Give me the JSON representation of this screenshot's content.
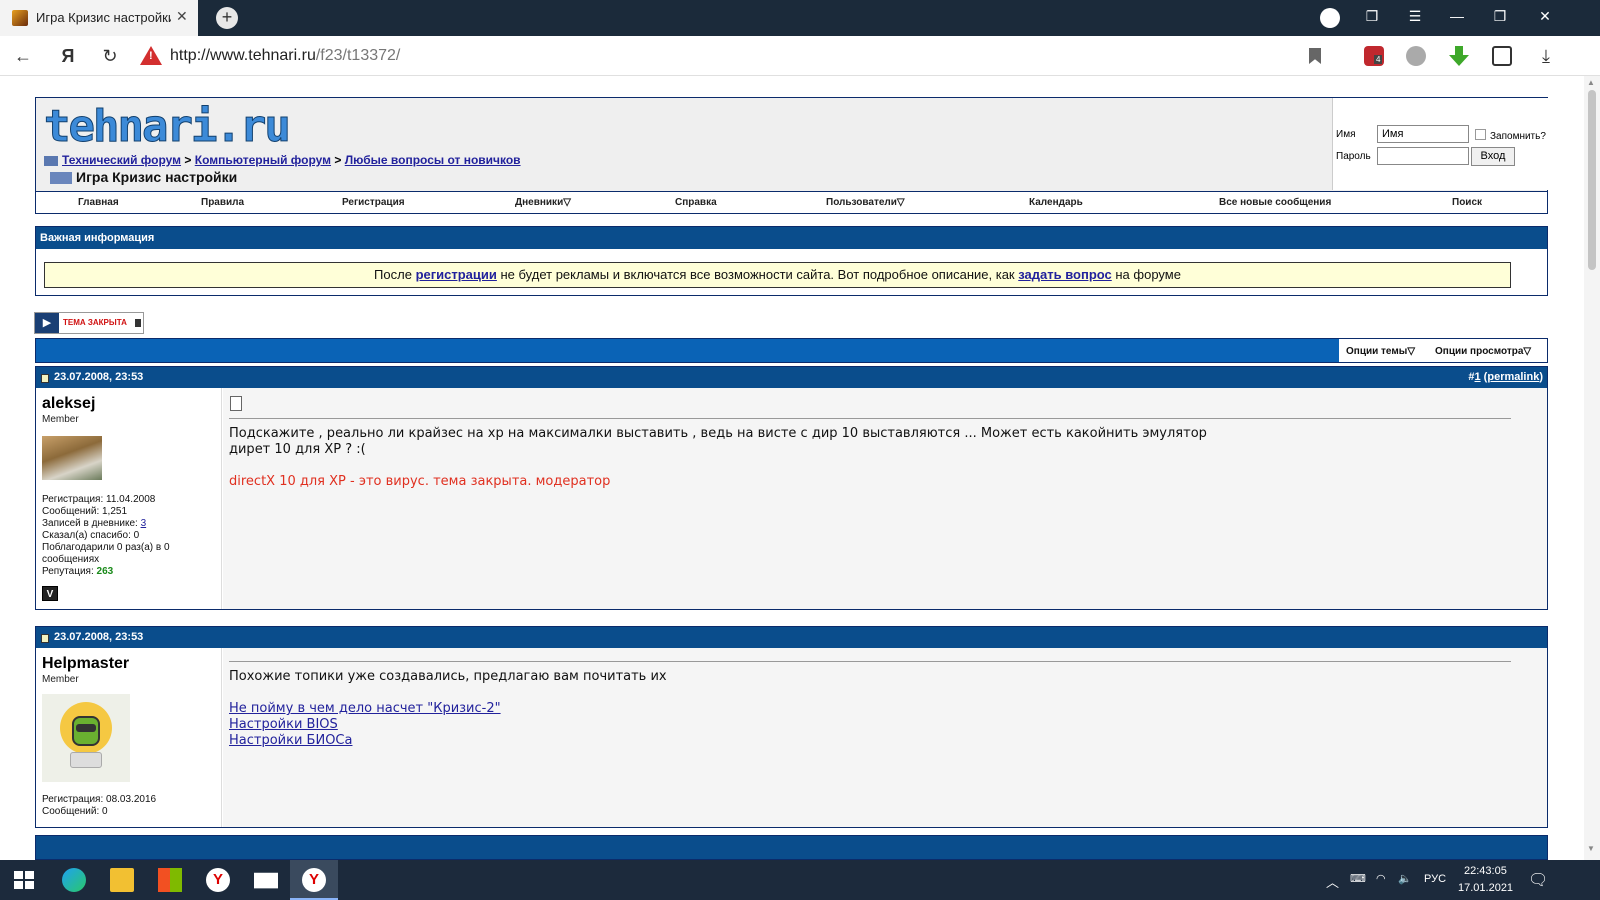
{
  "browser": {
    "tab_title": "Игра Кризис настройки",
    "url_host": "http://www.tehnari.ru",
    "url_path": "/f23/t13372/",
    "addon_badge": "4"
  },
  "header": {
    "logo_text": "tehnari.ru",
    "breadcrumb": [
      "Технический форум",
      "Компьютерный форум",
      "Любые вопросы от новичков"
    ],
    "breadcrumb_sep": ">",
    "current_thread": "Игра Кризис настройки"
  },
  "login": {
    "name_label": "Имя",
    "name_value": "Имя",
    "remember_label": "Запомнить?",
    "password_label": "Пароль",
    "login_button": "Вход"
  },
  "nav": [
    "Главная",
    "Правила",
    "Регистрация",
    "Дневники",
    "Справка",
    "Пользователи",
    "Календарь",
    "Все новые сообщения",
    "Поиск"
  ],
  "info": {
    "title": "Важная информация",
    "msg_before": "После ",
    "link1": "регистрации",
    "msg_mid": " не будет рекламы и включатся все возможности сайта. Вот подробное описание, как ",
    "link2": "задать вопрос",
    "msg_after": " на форуме"
  },
  "thread_closed_label": "тема закрыта",
  "thread_tools": {
    "thread_options": "Опции темы",
    "view_options": "Опции просмотра"
  },
  "posts": [
    {
      "date": "23.07.2008, 23:53",
      "number_prefix": "#",
      "number": "1",
      "permalink": "permalink",
      "username": "aleksej",
      "rank": "Member",
      "reg": "Регистрация: 11.04.2008",
      "messages": "Сообщений: 1,251",
      "diary_label": "Записей в дневнике: ",
      "diary_count": "3",
      "thanks_said": "Сказал(а) спасибо: 0",
      "thanked": "Поблагодарили 0 раз(а) в 0 сообщениях",
      "rep_label": "Репутация: ",
      "rep_value": "263",
      "text_line1": "Подскажите , реально ли крайзес на хр на максималки выставить , ведь на висте с дир 10 выставляются ... Может есть какойнить эмулятор",
      "text_line2": "дирет 10 для XP ? :(",
      "moderator_note": "directX 10 для XP - это вирус. тема закрыта. модератор"
    },
    {
      "date": "23.07.2008, 23:53",
      "username": "Helpmaster",
      "rank": "Member",
      "reg": "Регистрация: 08.03.2016",
      "messages": "Сообщений: 0",
      "text": "Похожие топики уже создавались, предлагаю вам почитать их",
      "links": [
        "Не пойму в чем дело насчет \"Кризис-2\"",
        "Настройки BIOS",
        "Настройки БИОСа"
      ]
    }
  ],
  "tray": {
    "lang": "РУС",
    "time": "22:43:05",
    "date": "17.01.2021"
  },
  "colors": {
    "header_blue": "#0a4d8c",
    "thread_bar_blue": "#0a63b6",
    "notice_bg": "#ffffd8",
    "reputation_green": "#1a8a1a",
    "moderator_red": "#e03020"
  }
}
